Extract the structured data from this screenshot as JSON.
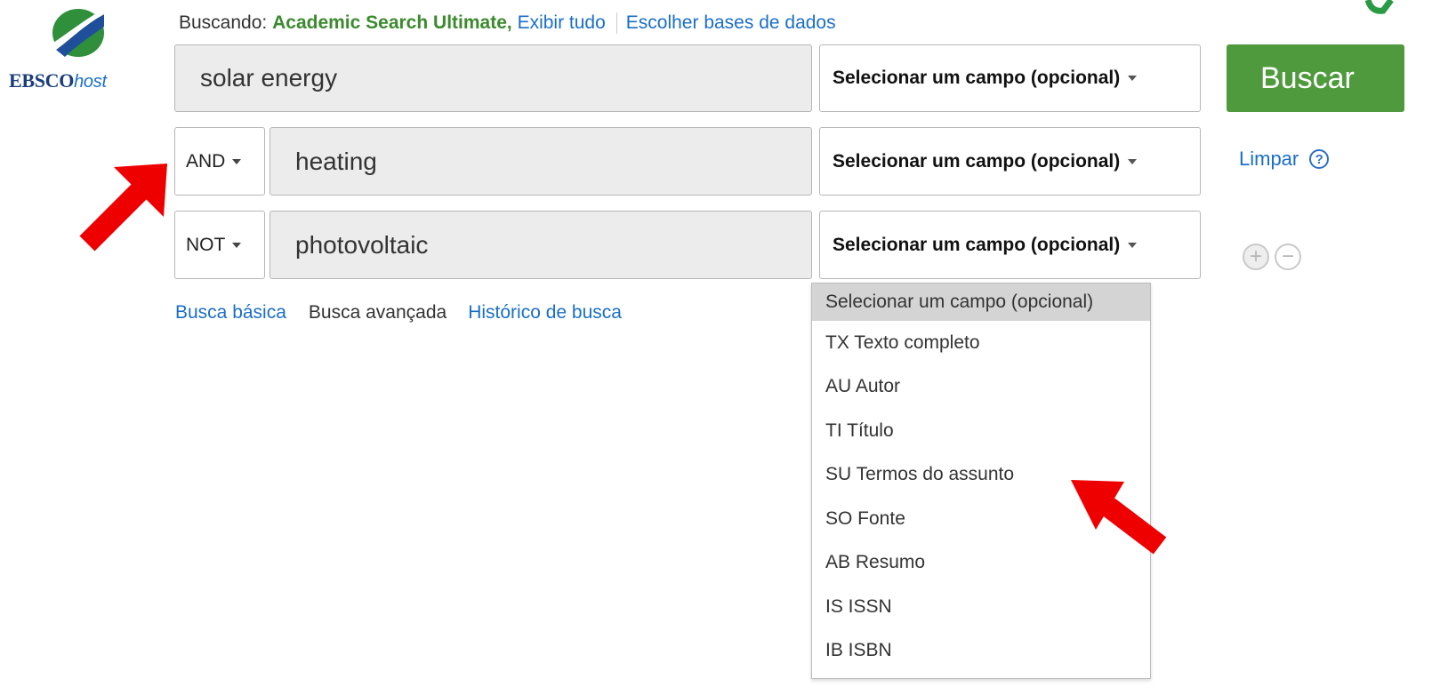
{
  "logo": {
    "brand": "EBSCO",
    "host": "host"
  },
  "header": {
    "searching_prefix": "Buscando:",
    "database": "Academic Search Ultimate,",
    "show_all": "Exibir tudo",
    "choose_databases": "Escolher bases de dados"
  },
  "search": {
    "rows": [
      {
        "boolean": "",
        "query": "solar energy",
        "field": "Selecionar um campo (opcional)"
      },
      {
        "boolean": "AND",
        "query": "heating",
        "field": "Selecionar um campo (opcional)"
      },
      {
        "boolean": "NOT",
        "query": "photovoltaic",
        "field": "Selecionar um campo (opcional)"
      }
    ],
    "button_label": "Buscar",
    "clear_label": "Limpar",
    "help_symbol": "?",
    "add_row_symbol": "+",
    "remove_row_symbol": "−"
  },
  "nav_links": {
    "basic": "Busca básica",
    "advanced": "Busca avançada",
    "history": "Histórico de busca"
  },
  "field_dropdown": {
    "options": [
      "Selecionar um campo (opcional)",
      "TX Texto completo",
      "AU Autor",
      "TI Título",
      "SU Termos do assunto",
      "SO Fonte",
      "AB Resumo",
      "IS ISSN",
      "IB ISBN"
    ],
    "selected_index": 0
  },
  "colors": {
    "search_button": "#4f9a3d",
    "link": "#1a6ec8",
    "database_name": "#3b8a2e",
    "annotation_arrow": "#ee0000"
  }
}
